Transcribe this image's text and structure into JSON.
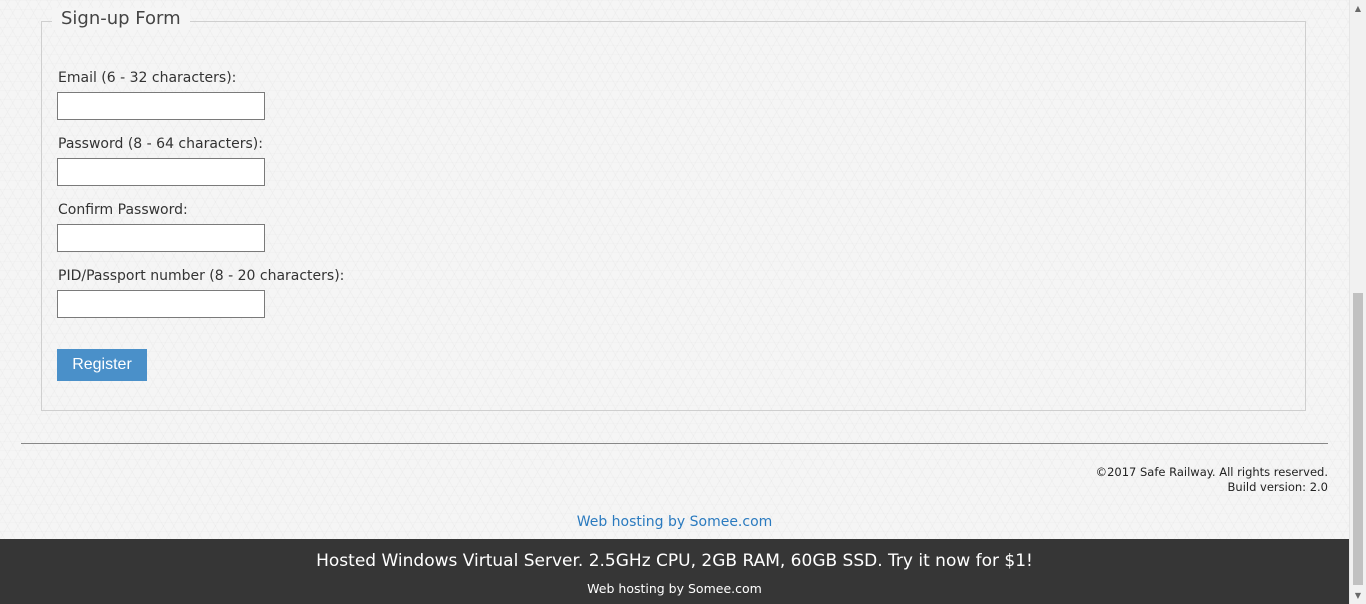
{
  "form": {
    "legend": "Sign-up Form",
    "fields": [
      {
        "label": "Email (6 - 32 characters):",
        "value": ""
      },
      {
        "label": "Password (8 - 64 characters):",
        "value": ""
      },
      {
        "label": "Confirm Password:",
        "value": ""
      },
      {
        "label": "PID/Passport number (8 - 20 characters):",
        "value": ""
      }
    ],
    "register_label": "Register"
  },
  "footer": {
    "copyright": "©2017 Safe Railway. All rights reserved.",
    "build_version": "Build version: 2.0",
    "hosting_link": "Web hosting by Somee.com"
  },
  "ad_bar": {
    "headline": "Hosted Windows Virtual Server. 2.5GHz CPU, 2GB RAM, 60GB SSD. Try it now for $1!",
    "subline": "Web hosting by Somee.com"
  },
  "scrollbar": {
    "up_icon": "triangle-up",
    "down_icon": "triangle-down",
    "position": "bottom"
  },
  "colors": {
    "accent": "#4a90c9",
    "link": "#2a7abf",
    "ad_background": "#363636"
  }
}
